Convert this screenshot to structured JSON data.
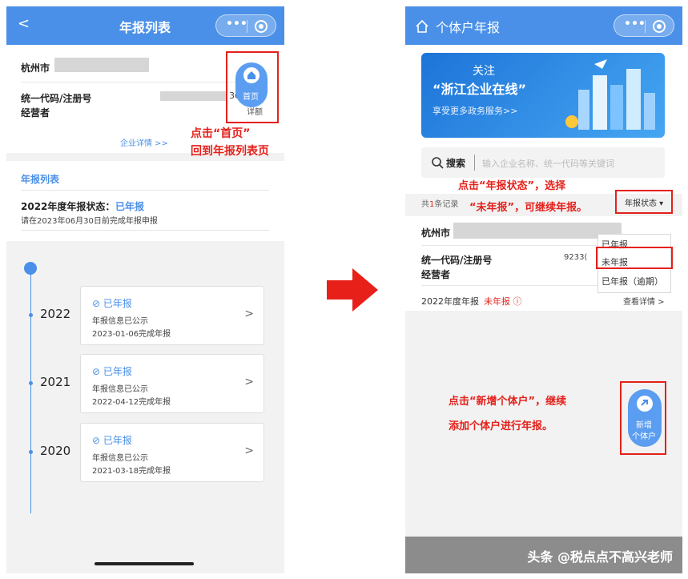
{
  "left": {
    "nav": {
      "title": "年报列表",
      "back": "<",
      "menu": "•••"
    },
    "company": {
      "city": "杭州市",
      "code_label": "统一代码/注册号",
      "code_value_tail": "3Q",
      "operator_label": "经营者",
      "detail_link": "企业详情 >>",
      "home_button": "首页",
      "home_button_under": "详额"
    },
    "annotation": {
      "line1": "点击“首页”",
      "line2": "回到年报列表页"
    },
    "list": {
      "title": "年报列表",
      "status_label": "2022年度年报状态：",
      "status_value": "已年报",
      "deadline": "请在2023年06月30日前完成年报申报"
    },
    "timeline": [
      {
        "year": "2022",
        "status": "已年报",
        "line1": "年报信息已公示",
        "line2": "2023-01-06完成年报"
      },
      {
        "year": "2021",
        "status": "已年报",
        "line1": "年报信息已公示",
        "line2": "2022-04-12完成年报"
      },
      {
        "year": "2020",
        "status": "已年报",
        "line1": "年报信息已公示",
        "line2": "2021-03-18完成年报"
      }
    ]
  },
  "arrow_color": "#e8201a",
  "right": {
    "nav": {
      "title": "个体户年报",
      "menu": "•••"
    },
    "banner": {
      "line1": "关注",
      "line2": "“浙江企业在线”",
      "line3": "享受更多政务服务>>"
    },
    "search": {
      "label": "搜索",
      "placeholder": "输入企业名称、统一代码等关键词"
    },
    "annotation_status": {
      "line1": "点击“年报状态”，选择",
      "line2": "“未年报”，可继续年报。"
    },
    "record_prefix": "共",
    "record_count": "1",
    "record_suffix": "条记录",
    "status_dropdown": "年报状态",
    "dropdown_options": [
      "已年报",
      "未年报",
      "已年报（逾期）"
    ],
    "company": {
      "city": "杭州市",
      "code_label": "统一代码/注册号",
      "code_value_head": "9233(",
      "operator_label": "经营者",
      "year_label": "2022年度年报",
      "year_status": "未年报",
      "detail_link": "查看详情 >"
    },
    "annotation_add": {
      "line1": "点击“新增个体户”，继续",
      "line2": "添加个体户进行年报。"
    },
    "add_button": {
      "line1": "新增",
      "line2": "个体户"
    },
    "watermark": "头条 @税点点不高兴老师"
  }
}
